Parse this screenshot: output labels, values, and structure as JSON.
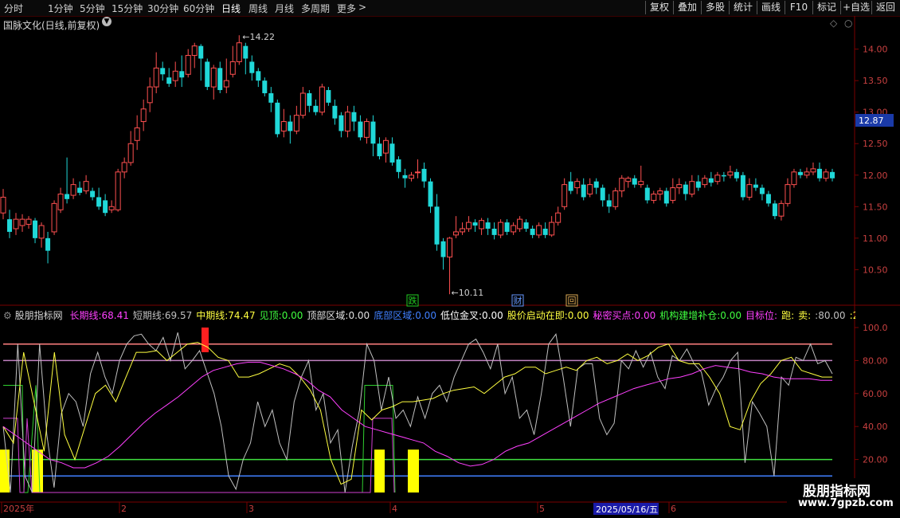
{
  "toolbar": {
    "periods": [
      "分时",
      "1分钟",
      "5分钟",
      "15分钟",
      "30分钟",
      "60分钟",
      "日线",
      "周线",
      "月线",
      "多周期",
      "更多"
    ],
    "more_arrow": ">",
    "right_buttons": [
      "复权",
      "叠加",
      "多股",
      "统计",
      "画线",
      "F10",
      "标记",
      "+自选",
      "返回"
    ]
  },
  "main_chart": {
    "stock_title": "国脉文化(日线,前复权)",
    "chevron_icon": "chevron-down-icon",
    "diamond_icon": "diamond-icon",
    "high_label": "14.22",
    "low_label": "10.11",
    "current_price": "12.87",
    "price_ticks": [
      "14.00",
      "13.50",
      "13.00",
      "12.50",
      "12.00",
      "11.50",
      "11.00",
      "10.50"
    ],
    "markers": [
      {
        "text": "跌",
        "color": "#22cc22"
      },
      {
        "text": "财",
        "color": "#6699ff"
      },
      {
        "text": "回",
        "color": "#ddaa55"
      }
    ],
    "colors": {
      "up": "#ff5050",
      "down": "#20d8d8"
    }
  },
  "indicator": {
    "name": "股朋指标网",
    "items": [
      {
        "label": "长期线:",
        "value": "68.41",
        "color": "#ff40ff"
      },
      {
        "label": "短期线:",
        "value": "69.57",
        "color": "#c0c0c0"
      },
      {
        "label": "中期线:",
        "value": "74.47",
        "color": "#ffff40"
      },
      {
        "label": "见顶:",
        "value": "0.00",
        "color": "#40ff40"
      },
      {
        "label": "顶部区域:",
        "value": "0.00",
        "color": "#e0e0e0"
      },
      {
        "label": "底部区域:",
        "value": "0.00",
        "color": "#4080ff"
      },
      {
        "label": "低位金叉:",
        "value": "0.00",
        "color": "#ffffff"
      },
      {
        "label": "股价启动在即:",
        "value": "0.00",
        "color": "#ffff40"
      },
      {
        "label": "秘密买点:",
        "value": "0.00",
        "color": "#ff40ff"
      },
      {
        "label": "机构建增补仓:",
        "value": "0.00",
        "color": "#40ff40"
      },
      {
        "label": "目标位:",
        "value": "",
        "color": "#ff40ff"
      },
      {
        "label": "跑:",
        "value": "",
        "color": "#ffff40"
      },
      {
        "label": "卖:",
        "value": "",
        "color": "#ffff40"
      },
      {
        "label": ":",
        "value": "80.00",
        "color": "#c0c0c0"
      },
      {
        "label": ":",
        "value": "20.00",
        "color": "#ffff40"
      }
    ],
    "ticks": [
      "100.0",
      "80.00",
      "60.00",
      "40.00",
      "20.00"
    ]
  },
  "xaxis": {
    "labels": [
      "2025年",
      "2",
      "3",
      "4",
      "5",
      "6"
    ],
    "cursor_date": "2025/05/16/五"
  },
  "watermark": {
    "line1": "股朋指标网",
    "line2": "www.7gpzb.com"
  },
  "chart_data": [
    {
      "type": "candlestick",
      "title": "国脉文化(日线,前复权)",
      "ylim": [
        10.1,
        14.4
      ],
      "candles": [
        [
          11.4,
          11.65,
          11.78,
          11.3
        ],
        [
          11.3,
          11.1,
          11.45,
          11.0
        ],
        [
          11.15,
          11.3,
          11.4,
          11.05
        ],
        [
          11.2,
          11.3,
          11.38,
          11.1
        ],
        [
          11.22,
          11.3,
          11.35,
          11.15
        ],
        [
          11.28,
          11.0,
          11.32,
          10.92
        ],
        [
          11.0,
          11.2,
          11.25,
          10.85
        ],
        [
          11.0,
          10.8,
          11.1,
          10.6
        ],
        [
          11.1,
          11.55,
          11.6,
          11.05
        ],
        [
          11.45,
          11.7,
          11.8,
          11.4
        ],
        [
          11.7,
          11.62,
          12.28,
          11.55
        ],
        [
          11.68,
          11.85,
          11.95,
          11.62
        ],
        [
          11.8,
          11.72,
          11.9,
          11.68
        ],
        [
          11.75,
          11.9,
          12.0,
          11.7
        ],
        [
          11.75,
          11.65,
          11.8,
          11.6
        ],
        [
          11.65,
          11.5,
          11.8,
          11.45
        ],
        [
          11.6,
          11.4,
          11.7,
          11.35
        ],
        [
          11.45,
          11.5,
          11.6,
          11.4
        ],
        [
          11.45,
          12.05,
          12.1,
          11.42
        ],
        [
          12.05,
          12.2,
          12.28,
          11.95
        ],
        [
          12.2,
          12.5,
          12.7,
          12.15
        ],
        [
          12.55,
          12.75,
          12.95,
          12.4
        ],
        [
          12.85,
          13.05,
          13.2,
          12.7
        ],
        [
          13.15,
          13.4,
          13.55,
          13.0
        ],
        [
          13.4,
          13.7,
          13.95,
          13.3
        ],
        [
          13.7,
          13.6,
          13.8,
          13.5
        ],
        [
          13.55,
          13.45,
          13.7,
          13.4
        ],
        [
          13.5,
          13.65,
          13.8,
          13.4
        ],
        [
          13.65,
          13.55,
          13.9,
          13.4
        ],
        [
          13.6,
          13.9,
          14.0,
          13.55
        ],
        [
          13.9,
          14.05,
          14.1,
          13.7
        ],
        [
          14.05,
          13.85,
          14.08,
          13.5
        ],
        [
          13.8,
          13.4,
          13.85,
          13.35
        ],
        [
          13.4,
          13.7,
          13.75,
          13.2
        ],
        [
          13.7,
          13.35,
          13.8,
          13.3
        ],
        [
          13.4,
          13.5,
          13.85,
          13.3
        ],
        [
          13.6,
          13.8,
          14.05,
          13.55
        ],
        [
          13.8,
          14.1,
          14.22,
          13.75
        ],
        [
          14.05,
          13.85,
          14.1,
          13.6
        ],
        [
          13.8,
          13.62,
          13.9,
          13.5
        ],
        [
          13.65,
          13.5,
          13.7,
          13.4
        ],
        [
          13.5,
          13.3,
          13.55,
          13.25
        ],
        [
          13.3,
          13.15,
          13.4,
          13.0
        ],
        [
          13.15,
          12.65,
          13.2,
          12.6
        ],
        [
          12.7,
          12.85,
          13.05,
          12.6
        ],
        [
          12.85,
          12.7,
          12.95,
          12.5
        ],
        [
          12.7,
          12.95,
          13.1,
          12.65
        ],
        [
          12.95,
          13.3,
          13.4,
          12.9
        ],
        [
          13.3,
          13.1,
          13.35,
          13.0
        ],
        [
          13.1,
          13.0,
          13.2,
          12.95
        ],
        [
          13.0,
          13.4,
          13.45,
          12.95
        ],
        [
          13.35,
          13.15,
          13.4,
          13.1
        ],
        [
          13.1,
          12.9,
          13.2,
          12.8
        ],
        [
          12.95,
          12.7,
          13.0,
          12.6
        ],
        [
          12.7,
          13.0,
          13.1,
          12.6
        ],
        [
          13.0,
          12.85,
          13.1,
          12.7
        ],
        [
          12.85,
          12.6,
          12.95,
          12.55
        ],
        [
          12.6,
          12.85,
          12.9,
          12.5
        ],
        [
          12.85,
          12.5,
          12.95,
          12.3
        ],
        [
          12.5,
          12.3,
          12.6,
          12.25
        ],
        [
          12.35,
          12.55,
          12.6,
          12.2
        ],
        [
          12.5,
          12.2,
          12.6,
          12.15
        ],
        [
          12.25,
          12.05,
          12.3,
          11.95
        ],
        [
          12.0,
          11.95,
          12.1,
          11.8
        ],
        [
          11.95,
          12.0,
          12.05,
          11.9
        ],
        [
          12.05,
          12.05,
          12.25,
          11.95
        ],
        [
          12.1,
          11.9,
          12.2,
          11.8
        ],
        [
          11.9,
          11.5,
          11.95,
          11.4
        ],
        [
          11.5,
          10.9,
          11.7,
          10.8
        ],
        [
          10.95,
          10.7,
          11.0,
          10.5
        ],
        [
          10.7,
          11.0,
          11.02,
          10.11
        ],
        [
          11.05,
          11.1,
          11.35,
          11.0
        ],
        [
          11.1,
          11.15,
          11.25,
          11.05
        ],
        [
          11.15,
          11.25,
          11.35,
          11.1
        ],
        [
          11.25,
          11.2,
          11.3,
          11.1
        ],
        [
          11.15,
          11.28,
          11.32,
          11.05
        ],
        [
          11.25,
          11.15,
          11.32,
          11.05
        ],
        [
          11.15,
          11.05,
          11.25,
          10.98
        ],
        [
          11.05,
          11.25,
          11.3,
          11.0
        ],
        [
          11.25,
          11.1,
          11.3,
          11.05
        ],
        [
          11.1,
          11.2,
          11.25,
          11.05
        ],
        [
          11.15,
          11.3,
          11.35,
          11.1
        ],
        [
          11.25,
          11.15,
          11.3,
          11.1
        ],
        [
          11.15,
          11.05,
          11.2,
          11.0
        ],
        [
          11.05,
          11.2,
          11.25,
          11.0
        ],
        [
          11.15,
          11.05,
          11.25,
          11.0
        ],
        [
          11.05,
          11.25,
          11.35,
          11.02
        ],
        [
          11.25,
          11.4,
          11.5,
          11.2
        ],
        [
          11.5,
          11.85,
          11.95,
          11.45
        ],
        [
          11.9,
          11.75,
          12.05,
          11.7
        ],
        [
          11.8,
          11.9,
          11.95,
          11.7
        ],
        [
          11.85,
          11.65,
          11.95,
          11.6
        ],
        [
          11.7,
          11.85,
          11.95,
          11.65
        ],
        [
          11.9,
          11.8,
          11.95,
          11.7
        ],
        [
          11.8,
          11.6,
          11.85,
          11.5
        ],
        [
          11.6,
          11.5,
          11.7,
          11.4
        ],
        [
          11.5,
          11.75,
          11.8,
          11.45
        ],
        [
          11.75,
          11.95,
          12.0,
          11.65
        ],
        [
          11.9,
          11.95,
          11.98,
          11.8
        ],
        [
          11.95,
          11.85,
          12.0,
          11.8
        ],
        [
          11.85,
          11.9,
          12.15,
          11.8
        ],
        [
          11.8,
          11.6,
          11.85,
          11.55
        ],
        [
          11.6,
          11.7,
          11.75,
          11.55
        ],
        [
          11.7,
          11.75,
          11.8,
          11.6
        ],
        [
          11.75,
          11.55,
          11.8,
          11.5
        ],
        [
          11.6,
          11.8,
          11.95,
          11.55
        ],
        [
          11.8,
          11.85,
          11.95,
          11.7
        ],
        [
          11.85,
          11.7,
          11.9,
          11.6
        ],
        [
          11.7,
          11.9,
          12.0,
          11.65
        ],
        [
          11.9,
          11.8,
          12.0,
          11.75
        ],
        [
          11.85,
          11.95,
          12.0,
          11.8
        ],
        [
          11.95,
          11.88,
          12.05,
          11.82
        ],
        [
          11.9,
          12.0,
          12.05,
          11.85
        ],
        [
          12.0,
          11.98,
          12.05,
          11.9
        ],
        [
          12.0,
          12.05,
          12.15,
          11.95
        ],
        [
          12.05,
          11.95,
          12.1,
          11.9
        ],
        [
          12.0,
          11.65,
          12.05,
          11.6
        ],
        [
          11.65,
          11.85,
          11.95,
          11.6
        ],
        [
          11.85,
          11.8,
          11.95,
          11.75
        ],
        [
          11.8,
          11.7,
          11.85,
          11.6
        ],
        [
          11.7,
          11.55,
          11.75,
          11.5
        ],
        [
          11.55,
          11.35,
          11.6,
          11.3
        ],
        [
          11.35,
          11.55,
          11.6,
          11.28
        ],
        [
          11.55,
          11.85,
          11.95,
          11.5
        ],
        [
          11.85,
          12.05,
          12.1,
          11.8
        ],
        [
          12.05,
          12.0,
          12.1,
          11.95
        ],
        [
          12.0,
          12.05,
          12.12,
          11.95
        ],
        [
          12.05,
          12.1,
          12.2,
          12.0
        ],
        [
          12.1,
          11.95,
          12.2,
          11.9
        ],
        [
          11.95,
          12.05,
          12.1,
          11.9
        ],
        [
          12.05,
          11.95,
          12.1,
          11.9
        ]
      ]
    },
    {
      "type": "line",
      "ylim": [
        0,
        100
      ],
      "yticks": [
        100,
        80,
        60,
        40,
        20
      ],
      "hlines": [
        {
          "y": 90,
          "color": "#ff8080"
        },
        {
          "y": 80,
          "color": "#c080c0"
        },
        {
          "y": 20,
          "color": "#40e040"
        },
        {
          "y": 10,
          "color": "#4080ff"
        }
      ],
      "series": [
        {
          "name": "短期线",
          "color": "#c0c0c0",
          "values": [
            40,
            0,
            90,
            10,
            0,
            90,
            35,
            3,
            48,
            60,
            55,
            40,
            72,
            85,
            70,
            60,
            80,
            90,
            95,
            96,
            90,
            86,
            94,
            80,
            97,
            75,
            80,
            86,
            73,
            60,
            40,
            10,
            2,
            20,
            30,
            55,
            40,
            50,
            30,
            20,
            55,
            70,
            80,
            50,
            60,
            30,
            38,
            0,
            28,
            50,
            90,
            80,
            50,
            70,
            45,
            50,
            40,
            58,
            45,
            60,
            65,
            55,
            70,
            80,
            90,
            93,
            85,
            75,
            90,
            60,
            70,
            45,
            50,
            35,
            60,
            90,
            96,
            70,
            40,
            75,
            78,
            78,
            45,
            35,
            42,
            80,
            75,
            86,
            76,
            85,
            70,
            63,
            83,
            80,
            87,
            78,
            73,
            53,
            63,
            70,
            80,
            85,
            18,
            55,
            48,
            40,
            10,
            70,
            65,
            82,
            80,
            90,
            78,
            80,
            72
          ]
        },
        {
          "name": "中期线",
          "color": "#ffff40",
          "values": [
            40,
            30,
            85,
            55,
            25,
            85,
            35,
            20,
            40,
            60,
            65,
            55,
            70,
            85,
            85,
            86,
            80,
            85,
            90,
            91,
            88,
            82,
            80,
            70,
            70,
            72,
            75,
            78,
            76,
            70,
            62,
            50,
            20,
            5,
            8,
            50,
            44,
            50,
            52,
            55,
            55,
            56,
            57,
            60,
            62,
            63,
            64,
            60,
            65,
            70,
            72,
            76,
            76,
            72,
            74,
            76,
            74,
            80,
            82,
            78,
            80,
            84,
            80,
            83,
            88,
            90,
            80,
            78,
            78,
            70,
            60,
            40,
            38,
            55,
            66,
            72,
            80,
            82,
            74,
            72,
            70,
            70
          ]
        },
        {
          "name": "长期线",
          "color": "#ff40ff",
          "values": [
            40,
            35,
            30,
            25,
            20,
            18,
            15,
            15,
            18,
            22,
            28,
            35,
            42,
            48,
            53,
            58,
            64,
            70,
            74,
            76,
            78,
            79,
            79,
            77,
            75,
            72,
            68,
            62,
            58,
            50,
            45,
            40,
            38,
            36,
            34,
            32,
            30,
            25,
            22,
            18,
            16,
            17,
            20,
            25,
            28,
            30,
            34,
            38,
            42,
            46,
            50,
            54,
            57,
            60,
            63,
            65,
            67,
            69,
            70,
            72,
            75,
            77,
            76,
            75,
            73,
            72,
            70,
            69,
            69,
            69,
            68,
            68
          ]
        }
      ]
    }
  ]
}
